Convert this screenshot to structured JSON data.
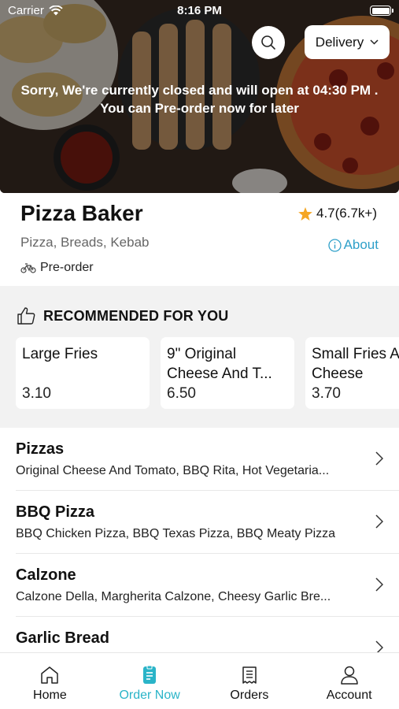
{
  "status_bar": {
    "carrier": "Carrier",
    "time": "8:16 PM"
  },
  "header": {
    "delivery_mode": "Delivery",
    "closed_message_line1": "Sorry, We're currently closed and will open at 04:30 PM .",
    "closed_message_line2": "You can Pre-order now for later"
  },
  "store": {
    "name": "Pizza Baker",
    "rating": "4.7(6.7k+)",
    "cuisine": "Pizza, Breads, Kebab",
    "about_label": "About",
    "preorder_label": "Pre-order"
  },
  "recommended": {
    "title": "RECOMMENDED FOR YOU",
    "items": [
      {
        "name_line1": "Large Fries",
        "name_line2": "",
        "price": "3.10"
      },
      {
        "name_line1": "9\" Original",
        "name_line2": "Cheese And T...",
        "price": "6.50"
      },
      {
        "name_line1": "Small Fries A",
        "name_line2": "Cheese",
        "price": "3.70"
      }
    ]
  },
  "categories": [
    {
      "name": "Pizzas",
      "description": "Original Cheese And Tomato, BBQ Rita, Hot Vegetaria..."
    },
    {
      "name": "BBQ Pizza",
      "description": "BBQ Chicken Pizza, BBQ Texas Pizza, BBQ Meaty Pizza"
    },
    {
      "name": "Calzone",
      "description": "Calzone Della, Margherita Calzone, Cheesy Garlic Bre..."
    },
    {
      "name": "Garlic Bread",
      "description": ""
    }
  ],
  "tabs": [
    {
      "label": "Home",
      "icon": "home-icon",
      "active": false
    },
    {
      "label": "Order Now",
      "icon": "order-icon",
      "active": true
    },
    {
      "label": "Orders",
      "icon": "receipt-icon",
      "active": false
    },
    {
      "label": "Account",
      "icon": "user-icon",
      "active": false
    }
  ],
  "colors": {
    "accent": "#2ab4c8",
    "link": "#2fa0c9",
    "star": "#f5a623",
    "section_bg": "#f2f2f2"
  }
}
